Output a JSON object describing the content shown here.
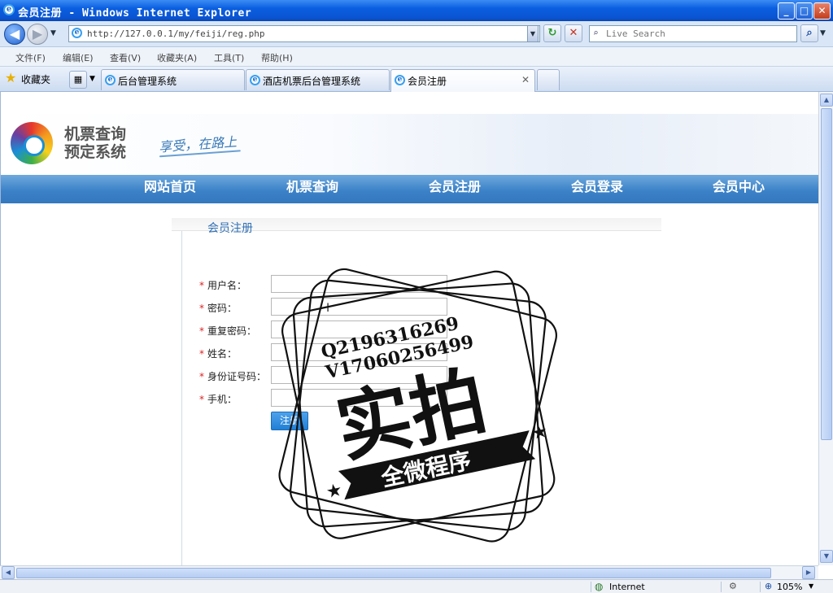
{
  "window": {
    "title": "会员注册 - Windows Internet Explorer",
    "minimize": "_",
    "maximize": "□",
    "close": "✕"
  },
  "address_bar": {
    "url": "http://127.0.0.1/my/feiji/reg.php",
    "search_placeholder": "Live Search",
    "back": "◀",
    "forward": "▶",
    "dropdown": "▼",
    "refresh": "↻",
    "stop": "✕",
    "search_go": "⌕"
  },
  "menu": [
    "文件(F)",
    "编辑(E)",
    "查看(V)",
    "收藏夹(A)",
    "工具(T)",
    "帮助(H)"
  ],
  "favorites_label": "收藏夹",
  "tabs": [
    {
      "label": "后台管理系统"
    },
    {
      "label": "酒店机票后台管理系统"
    },
    {
      "label": "会员注册"
    }
  ],
  "site": {
    "logo_text_line1": "机票查询",
    "logo_text_line2": "预定系统",
    "slogan": "享受，在路上"
  },
  "nav": [
    "网站首页",
    "机票查询",
    "会员注册",
    "会员登录",
    "会员中心"
  ],
  "form": {
    "section_title": "会员注册",
    "fields": [
      {
        "label": "用户名："
      },
      {
        "label": "密码："
      },
      {
        "label": "重复密码："
      },
      {
        "label": "姓名："
      },
      {
        "label": "身份证号码："
      },
      {
        "label": "手机："
      }
    ],
    "required_mark": "*",
    "submit_label": "注册"
  },
  "watermark": {
    "line1": "Q2196316269",
    "line2": "V17060256499",
    "main": "实拍",
    "ribbon": "全微程序"
  },
  "status_bar": {
    "zone": "Internet",
    "zoom": "105%"
  },
  "colors": {
    "nav_blue": "#3c82c8",
    "accent_blue": "#2f6fb5",
    "button_blue": "#1f7fd6",
    "required_red": "#dd2222"
  }
}
